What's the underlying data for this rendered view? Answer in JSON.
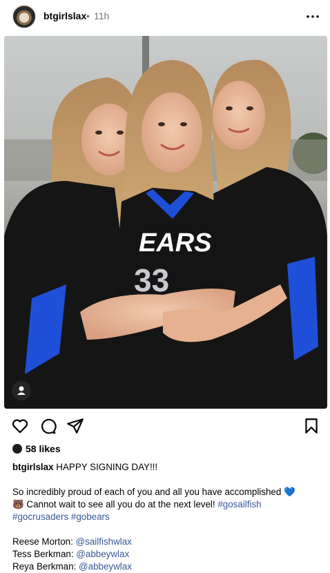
{
  "post": {
    "username": "btgirlslax",
    "separator": "•",
    "time": "11h",
    "photo_jersey_text": "EARS",
    "likes": "58 likes",
    "caption": {
      "username": "btgirlslax",
      "headline": "HAPPY SIGNING DAY!!!",
      "line1": "So incredibly proud of each of you and all you have accomplished",
      "emoji1": "💙",
      "emoji2": "🐻",
      "line2": "Cannot wait to see all you do at the next level!",
      "tag1": "#gosailfish",
      "tag2": "#gocrusaders",
      "tag3": "#gobears",
      "names": [
        {
          "label": "Reese Morton:",
          "handle": "@sailfishwlax"
        },
        {
          "label": "Tess Berkman:",
          "handle": "@abbeywlax"
        },
        {
          "label": "Reya Berkman:",
          "handle": "@abbeywlax"
        }
      ]
    }
  },
  "icons": {
    "more": "more-horizontal-icon",
    "like": "heart-icon",
    "comment": "comment-icon",
    "share": "send-icon",
    "save": "bookmark-icon",
    "tag": "user-tag-icon"
  },
  "colors": {
    "link": "#385898",
    "muted": "#737373",
    "jersey": "#1a1a1a",
    "jersey_blue": "#1f4fd8"
  }
}
